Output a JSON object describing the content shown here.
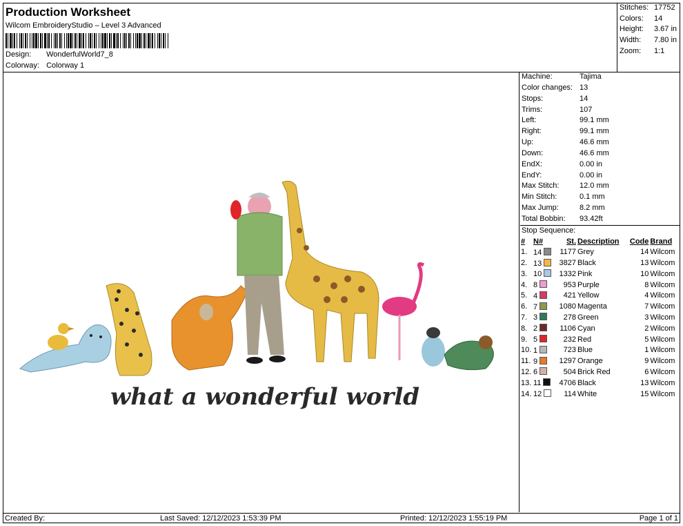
{
  "header": {
    "title": "Production Worksheet",
    "software": "Wilcom EmbroideryStudio – Level 3 Advanced",
    "design_label": "Design:",
    "design_value": "WonderfulWorld7_8",
    "colorway_label": "Colorway:",
    "colorway_value": "Colorway 1"
  },
  "stats": [
    {
      "label": "Stitches:",
      "value": "17752"
    },
    {
      "label": "Colors:",
      "value": "14"
    },
    {
      "label": "Height:",
      "value": "3.67 in"
    },
    {
      "label": "Width:",
      "value": "7.80 in"
    },
    {
      "label": "Zoom:",
      "value": "1:1"
    }
  ],
  "properties": [
    {
      "label": "Machine:",
      "value": "Tajima"
    },
    {
      "label": "Color changes:",
      "value": "13"
    },
    {
      "label": "Stops:",
      "value": "14"
    },
    {
      "label": "Trims:",
      "value": "107"
    },
    {
      "label": "Left:",
      "value": "99.1 mm"
    },
    {
      "label": "Right:",
      "value": "99.1 mm"
    },
    {
      "label": "Up:",
      "value": "46.6 mm"
    },
    {
      "label": "Down:",
      "value": "46.6 mm"
    },
    {
      "label": "EndX:",
      "value": "0.00 in"
    },
    {
      "label": "EndY:",
      "value": "0.00 in"
    },
    {
      "label": "Max Stitch:",
      "value": "12.0 mm"
    },
    {
      "label": "Min Stitch:",
      "value": "0.1 mm"
    },
    {
      "label": "Max Jump:",
      "value": "8.2 mm"
    },
    {
      "label": "Total Bobbin:",
      "value": "93.42ft"
    }
  ],
  "stop_sequence": {
    "title": "Stop Sequence:",
    "columns": [
      "#",
      "N#",
      "St.",
      "Description",
      "Code",
      "Brand"
    ],
    "rows": [
      {
        "idx": "1.",
        "n": "14",
        "color": "#8a8a8a",
        "st": "1177",
        "desc": "Grey",
        "code": "14",
        "brand": "Wilcom"
      },
      {
        "idx": "2.",
        "n": "13",
        "color": "#f2b84a",
        "st": "3827",
        "desc": "Black",
        "code": "13",
        "brand": "Wilcom"
      },
      {
        "idx": "3.",
        "n": "10",
        "color": "#a9c7e6",
        "st": "1332",
        "desc": "Pink",
        "code": "10",
        "brand": "Wilcom"
      },
      {
        "idx": "4.",
        "n": "8",
        "color": "#ef9ad2",
        "st": "953",
        "desc": "Purple",
        "code": "8",
        "brand": "Wilcom"
      },
      {
        "idx": "5.",
        "n": "4",
        "color": "#d93a6a",
        "st": "421",
        "desc": "Yellow",
        "code": "4",
        "brand": "Wilcom"
      },
      {
        "idx": "6.",
        "n": "7",
        "color": "#8e9a4a",
        "st": "1080",
        "desc": "Magenta",
        "code": "7",
        "brand": "Wilcom"
      },
      {
        "idx": "7.",
        "n": "3",
        "color": "#2c7a5a",
        "st": "278",
        "desc": "Green",
        "code": "3",
        "brand": "Wilcom"
      },
      {
        "idx": "8.",
        "n": "2",
        "color": "#6a2a2a",
        "st": "1106",
        "desc": "Cyan",
        "code": "2",
        "brand": "Wilcom"
      },
      {
        "idx": "9.",
        "n": "5",
        "color": "#e0242a",
        "st": "232",
        "desc": "Red",
        "code": "5",
        "brand": "Wilcom"
      },
      {
        "idx": "10.",
        "n": "1",
        "color": "#b8b8b8",
        "st": "723",
        "desc": "Blue",
        "code": "1",
        "brand": "Wilcom"
      },
      {
        "idx": "11.",
        "n": "9",
        "color": "#e8782a",
        "st": "1297",
        "desc": "Orange",
        "code": "9",
        "brand": "Wilcom"
      },
      {
        "idx": "12.",
        "n": "6",
        "color": "#d4b0aa",
        "st": "504",
        "desc": "Brick Red",
        "code": "6",
        "brand": "Wilcom"
      },
      {
        "idx": "13.",
        "n": "11",
        "color": "#111111",
        "st": "4706",
        "desc": "Black",
        "code": "13",
        "brand": "Wilcom"
      },
      {
        "idx": "14.",
        "n": "12",
        "color": "#ffffff",
        "st": "114",
        "desc": "White",
        "code": "15",
        "brand": "Wilcom"
      }
    ]
  },
  "preview": {
    "caption": "what a wonderful world"
  },
  "footer": {
    "created_by": "Created By:",
    "last_saved": "Last Saved: 12/12/2023 1:53:39 PM",
    "printed": "Printed: 12/12/2023 1:55:19 PM",
    "page": "Page 1 of 1"
  }
}
